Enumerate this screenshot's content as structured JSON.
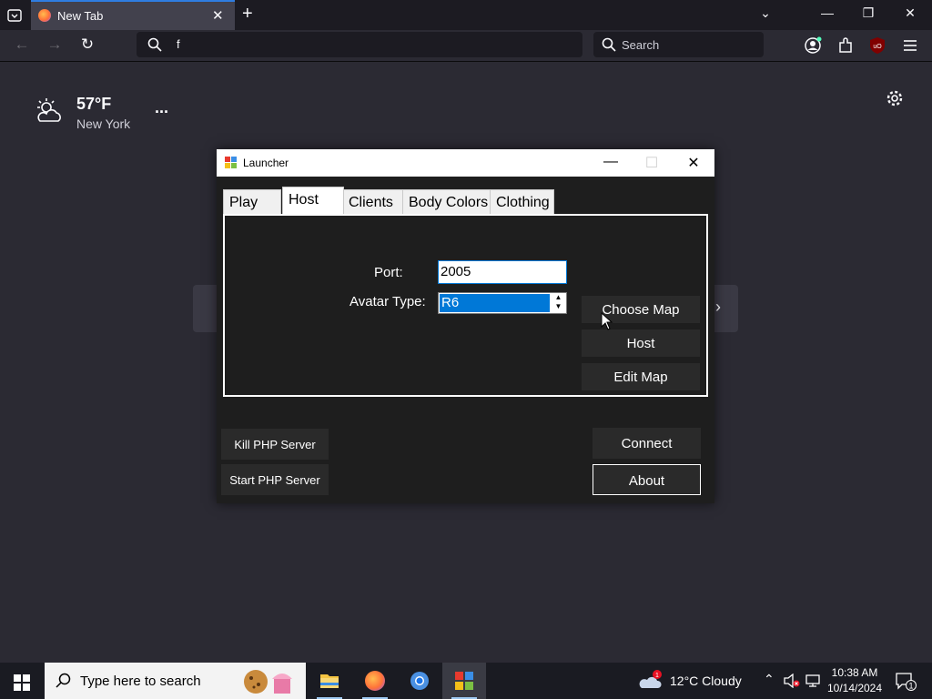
{
  "browser": {
    "tab_title": "New Tab",
    "url_text": "f",
    "search_placeholder": "Search"
  },
  "newtab": {
    "weather_temp": "57°F",
    "weather_location": "New York",
    "more_label": "..."
  },
  "launcher": {
    "title": "Launcher",
    "tabs": [
      "Play",
      "Host",
      "Clients",
      "Body Colors",
      "Clothing"
    ],
    "active_tab": "Host",
    "port_label": "Port:",
    "port_value": "2005",
    "avatar_label": "Avatar Type:",
    "avatar_value": "R6",
    "buttons": {
      "choose_map": "Choose Map",
      "host": "Host",
      "edit_map": "Edit Map",
      "kill_php": "Kill PHP Server",
      "start_php": "Start PHP Server",
      "connect": "Connect",
      "about": "About"
    }
  },
  "taskbar": {
    "search_placeholder": "Type here to search",
    "weather": "12°C  Cloudy",
    "time": "10:38 AM",
    "date": "10/14/2024",
    "notification_count": "1",
    "weather_alert_count": "1"
  },
  "colors": {
    "accent": "#0078d7",
    "firefox_accent": "#2f7de1"
  }
}
